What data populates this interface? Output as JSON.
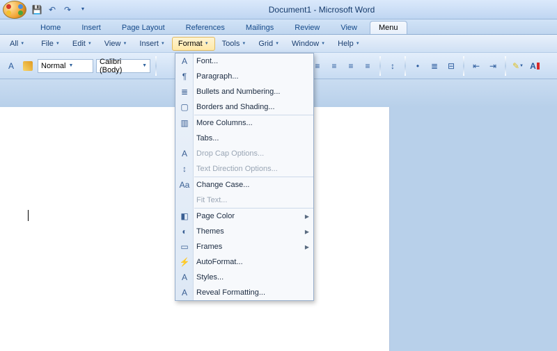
{
  "window": {
    "title": "Document1  -  Microsoft Word"
  },
  "ribbon_tabs": [
    {
      "label": "Home"
    },
    {
      "label": "Insert"
    },
    {
      "label": "Page Layout"
    },
    {
      "label": "References"
    },
    {
      "label": "Mailings"
    },
    {
      "label": "Review"
    },
    {
      "label": "View"
    },
    {
      "label": "Menu",
      "active": true
    }
  ],
  "menubar": [
    {
      "label": "All"
    },
    {
      "label": "File"
    },
    {
      "label": "Edit"
    },
    {
      "label": "View"
    },
    {
      "label": "Insert"
    },
    {
      "label": "Format",
      "open": true
    },
    {
      "label": "Tools"
    },
    {
      "label": "Grid"
    },
    {
      "label": "Window"
    },
    {
      "label": "Help"
    }
  ],
  "style_combo": {
    "value": "Normal"
  },
  "font_combo": {
    "value": "Calibri (Body)"
  },
  "format_menu": [
    {
      "label": "Font...",
      "icon": "font-icon"
    },
    {
      "label": "Paragraph...",
      "icon": "paragraph-icon"
    },
    {
      "label": "Bullets and Numbering...",
      "icon": "bullets-icon"
    },
    {
      "label": "Borders and Shading...",
      "icon": "borders-icon"
    },
    {
      "sep": true
    },
    {
      "label": "More Columns...",
      "icon": "columns-icon"
    },
    {
      "label": "Tabs...",
      "icon": ""
    },
    {
      "label": "Drop Cap Options...",
      "icon": "dropcap-icon",
      "disabled": true
    },
    {
      "label": "Text Direction Options...",
      "icon": "textdir-icon",
      "disabled": true
    },
    {
      "sep": true
    },
    {
      "label": "Change Case...",
      "icon": "case-icon"
    },
    {
      "label": "Fit Text...",
      "icon": "",
      "disabled": true
    },
    {
      "sep": true
    },
    {
      "label": "Page Color",
      "icon": "color-icon",
      "submenu": true
    },
    {
      "label": "Themes",
      "icon": "themes-icon",
      "submenu": true
    },
    {
      "label": "Frames",
      "icon": "frames-icon",
      "submenu": true
    },
    {
      "label": "AutoFormat...",
      "icon": "autoformat-icon"
    },
    {
      "label": "Styles...",
      "icon": "styles-icon"
    },
    {
      "label": "Reveal Formatting...",
      "icon": "reveal-icon"
    }
  ]
}
